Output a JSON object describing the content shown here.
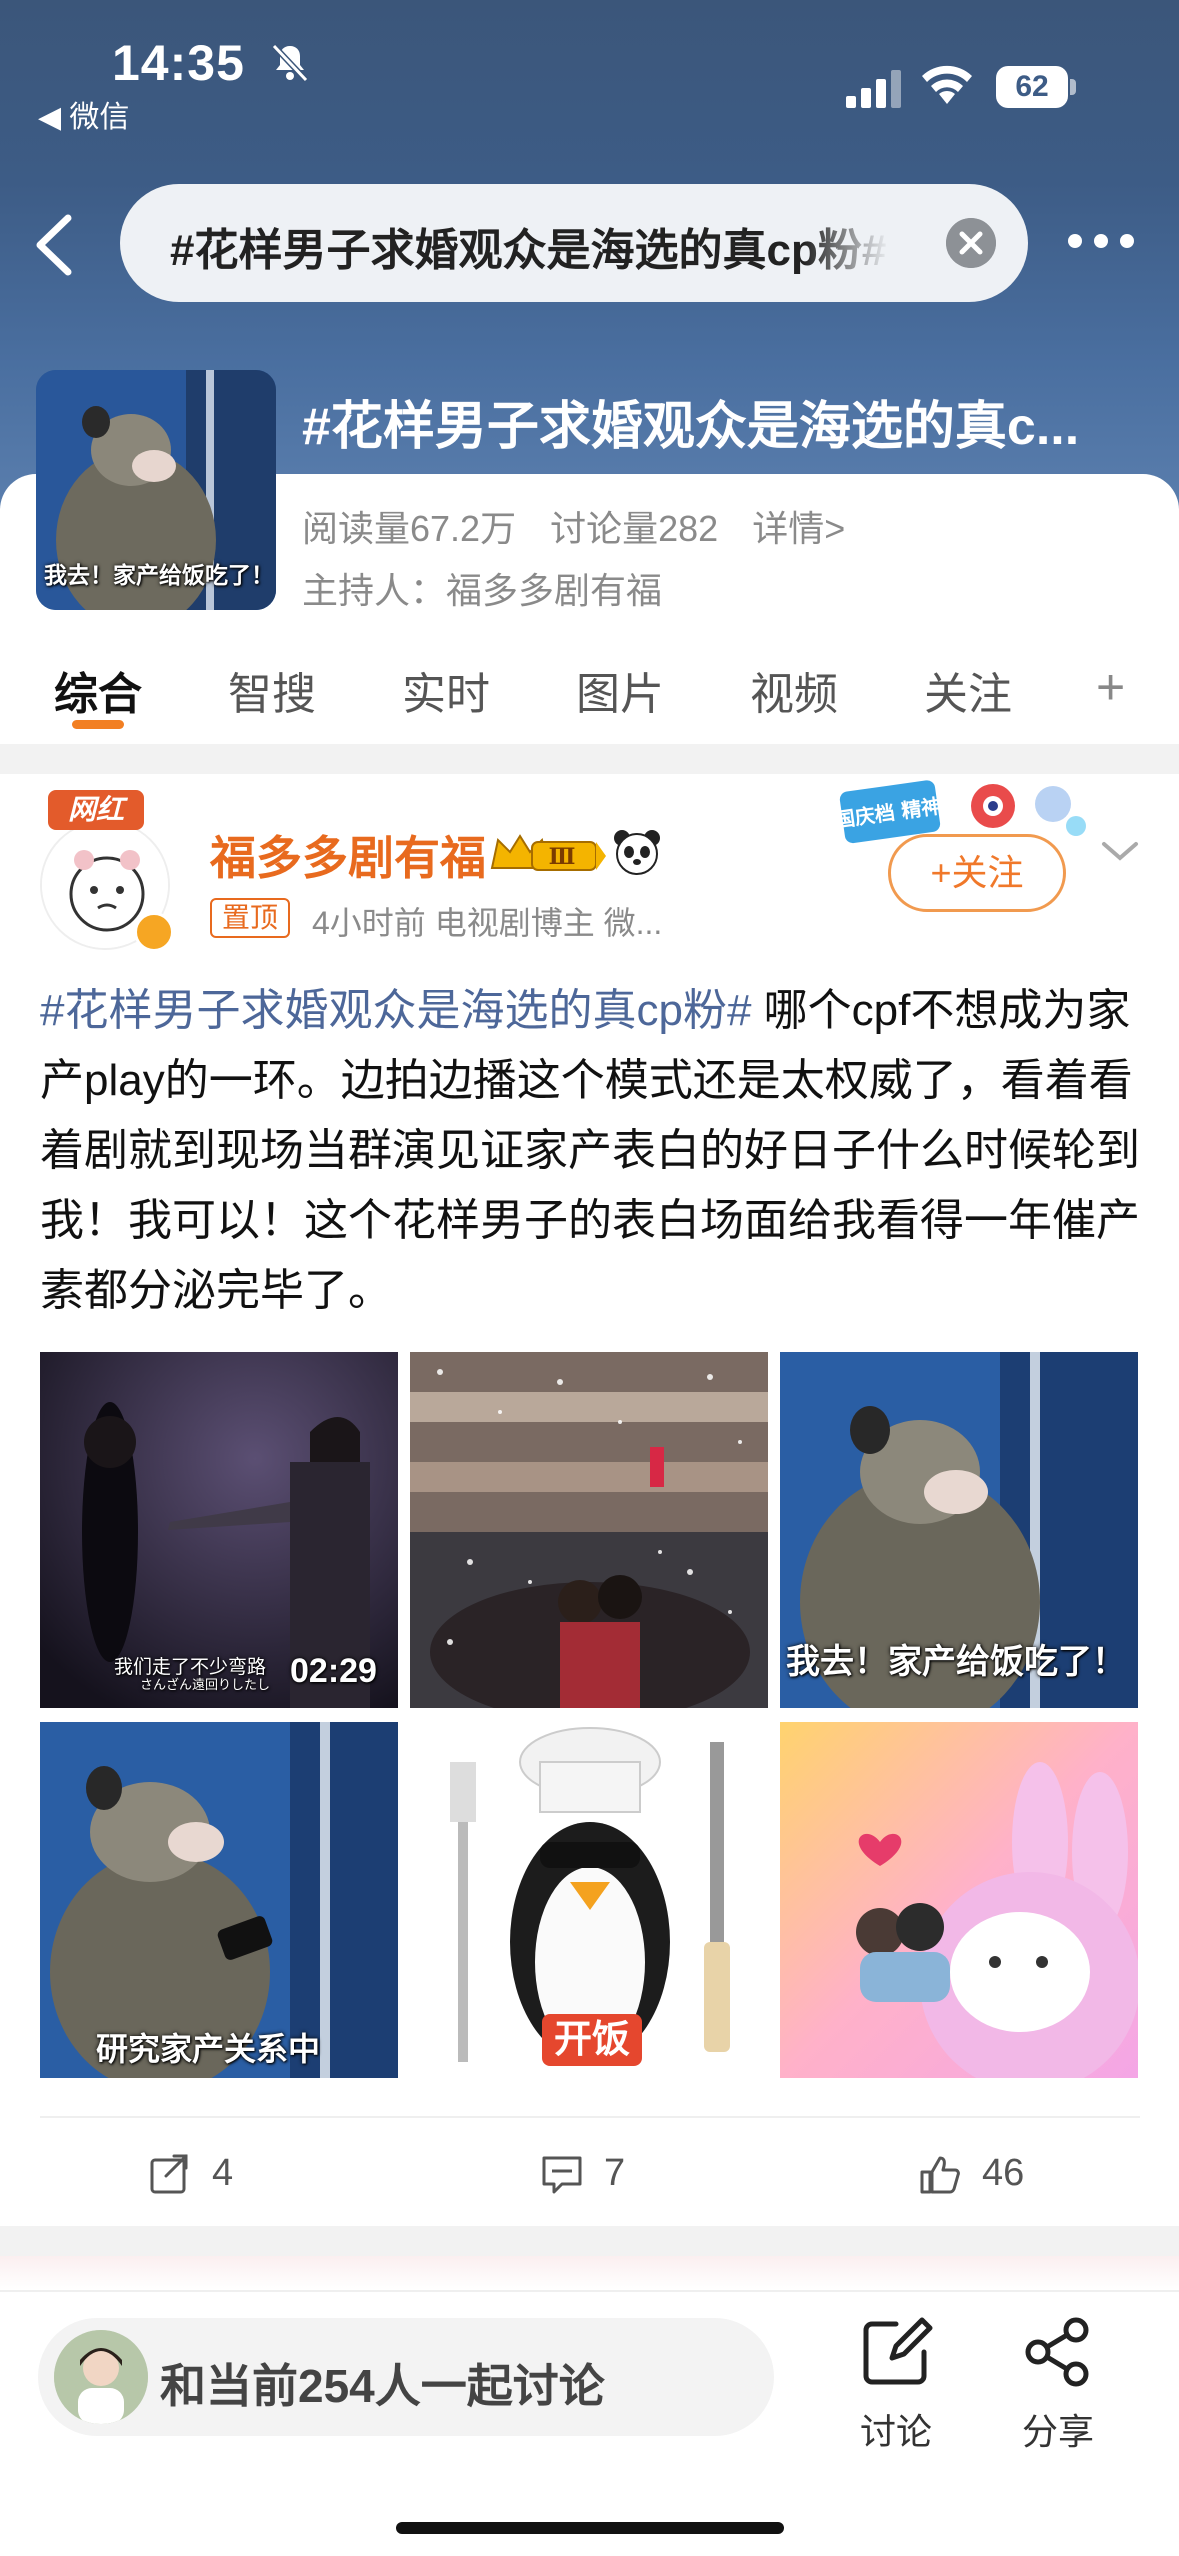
{
  "status_bar": {
    "time": "14:35",
    "back_app": "◀ 微信",
    "battery": "62"
  },
  "search": {
    "query": "#花样男子求婚观众是海选的真cp粉#"
  },
  "topic": {
    "title": "#花样男子求婚观众是海选的真c...",
    "thumb_caption": "我去！家产给饭吃了！",
    "read_count": "阅读量67.2万",
    "discuss_count": "讨论量282",
    "details": "详情>",
    "host": "主持人：福多多剧有福"
  },
  "tabs": [
    {
      "label": "综合",
      "active": true
    },
    {
      "label": "智搜"
    },
    {
      "label": "实时"
    },
    {
      "label": "图片"
    },
    {
      "label": "视频"
    },
    {
      "label": "关注"
    }
  ],
  "tab_plus": "+",
  "post": {
    "badge": "网红",
    "author": "福多多剧有福",
    "level": "Ⅲ",
    "pinned": "置顶",
    "meta": "4小时前  电视剧博主 微...",
    "banner_text": "国庆档 精神",
    "follow": "+关注",
    "hashtag": "#花样男子求婚观众是海选的真cp粉#",
    "body": " 哪个cpf不想成为家产play的一环。边拍边播这个模式还是太权威了，看着看着剧就到现场当群演见证家产表白的好日子什么时候轮到我！我可以！这个花样男子的表白场面给我看得一年催产素都分泌完毕了。",
    "images": [
      {
        "caption": "我们走了不少弯路",
        "caption_sub": "さんざん遠回りしたし",
        "duration": "02:29"
      },
      {
        "caption": ""
      },
      {
        "caption": "我去！家产给饭吃了！"
      },
      {
        "caption": "研究家产关系中"
      },
      {
        "caption": "开饭"
      },
      {
        "caption": ""
      }
    ],
    "reposts": "4",
    "comments": "7",
    "likes": "46"
  },
  "bottom": {
    "discuss_text": "和当前254人一起讨论",
    "discuss_label": "讨论",
    "share_label": "分享"
  },
  "colors": {
    "accent_orange": "#f27f22",
    "hashtag_blue": "#4d6799",
    "header_blue": "#3d5c86"
  }
}
